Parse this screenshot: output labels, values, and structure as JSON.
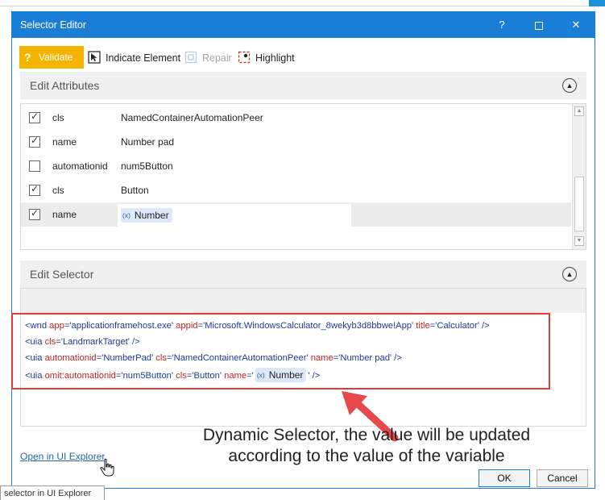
{
  "window": {
    "title": "Selector Editor",
    "help_label": "?",
    "minimize_label": "—",
    "close_label": "✕"
  },
  "toolbar": {
    "validate_label": "Validate",
    "validate_icon": "question-mark-icon",
    "indicate_label": "Indicate Element",
    "repair_label": "Repair",
    "highlight_label": "Highlight"
  },
  "attributes": {
    "section_title": "Edit Attributes",
    "rows": [
      {
        "checked": true,
        "key": "cls",
        "value": "NamedContainerAutomationPeer"
      },
      {
        "checked": true,
        "key": "name",
        "value": "Number pad"
      },
      {
        "checked": false,
        "key": "automationid",
        "value": "num5Button"
      },
      {
        "checked": true,
        "key": "cls",
        "value": "Button"
      },
      {
        "checked": true,
        "key": "name",
        "value": "Number",
        "is_variable": true
      }
    ]
  },
  "selector": {
    "section_title": "Edit Selector",
    "lines": [
      {
        "tag_open": "<wnd ",
        "parts": [
          {
            "attr": "app",
            "val": "'applicationframehost.exe'"
          },
          {
            "attr": "appid",
            "val": "'Microsoft.WindowsCalculator_8wekyb3d8bbwe!App'"
          },
          {
            "attr": "title",
            "val": "'Calculator'"
          }
        ],
        "tag_close": " />"
      },
      {
        "tag_open": "<uia ",
        "parts": [
          {
            "attr": "cls",
            "val": "'LandmarkTarget'"
          }
        ],
        "tag_close": " />"
      },
      {
        "tag_open": "<uia ",
        "parts": [
          {
            "attr": "automationid",
            "val": "'NumberPad'"
          },
          {
            "attr": "cls",
            "val": "'NamedContainerAutomationPeer'"
          },
          {
            "attr": "name",
            "val": "'Number pad'"
          }
        ],
        "tag_close": " />"
      },
      {
        "tag_open": "<uia ",
        "parts": [
          {
            "attr": "omit:automationid",
            "val": "'num5Button'"
          },
          {
            "attr": "cls",
            "val": "'Button'"
          },
          {
            "attr": "name",
            "val": "'"
          }
        ],
        "variable": "Number",
        "tag_close": "' />"
      }
    ]
  },
  "variable_chip_prefix": "(x)",
  "annotation": {
    "line1": "Dynamic Selector, the value will be updated",
    "line2": "according to the value of the variable"
  },
  "footer": {
    "explorer_link": "Open in UI Explorer",
    "ok_label": "OK",
    "cancel_label": "Cancel"
  },
  "tooltip": "selector in UI Explorer",
  "colors": {
    "titlebar": "#1a7dd6",
    "validate": "#f5b400",
    "highlight_border": "#e23a3a",
    "annotation_arrow": "#e8484a"
  }
}
